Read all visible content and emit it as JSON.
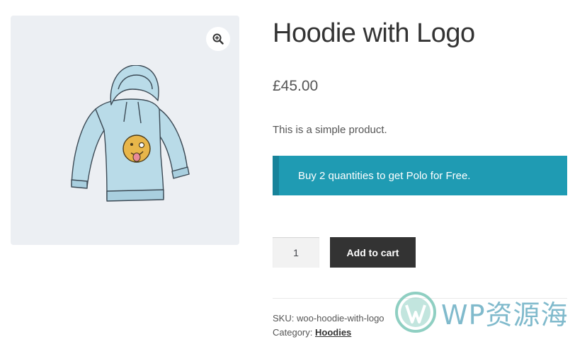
{
  "product": {
    "title": "Hoodie with Logo",
    "price": "£45.00",
    "short_description": "This is a simple product."
  },
  "notice": {
    "text": "Buy 2 quantities to get Polo for Free.",
    "background_color": "#1f9bb3"
  },
  "gallery": {
    "image_icon": "hoodie-image",
    "zoom_icon": "magnify-plus-icon"
  },
  "cart_form": {
    "quantity_value": "1",
    "add_to_cart_label": "Add to cart",
    "button_color": "#333333"
  },
  "meta": {
    "sku_label": "SKU:",
    "sku_value": "woo-hoodie-with-logo",
    "category_label": "Category:",
    "category_value": "Hoodies"
  },
  "watermark": {
    "text": "WP资源海",
    "logo_icon": "wordpress-logo-icon"
  }
}
